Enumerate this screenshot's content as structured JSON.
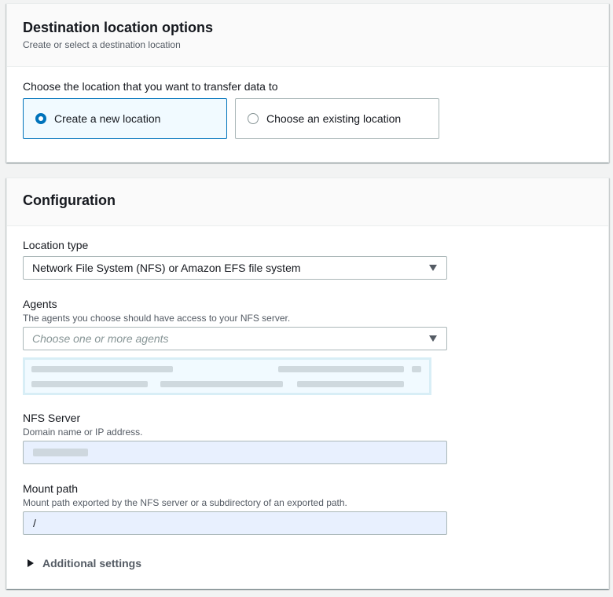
{
  "destination": {
    "title": "Destination location options",
    "description": "Create or select a destination location",
    "choose_label": "Choose the location that you want to transfer data to",
    "options": [
      {
        "label": "Create a new location",
        "selected": true
      },
      {
        "label": "Choose an existing location",
        "selected": false
      }
    ]
  },
  "configuration": {
    "title": "Configuration",
    "location_type": {
      "label": "Location type",
      "value": "Network File System (NFS) or Amazon EFS file system"
    },
    "agents": {
      "label": "Agents",
      "description": "The agents you choose should have access to your NFS server.",
      "placeholder": "Choose one or more agents"
    },
    "nfs_server": {
      "label": "NFS Server",
      "description": "Domain name or IP address."
    },
    "mount_path": {
      "label": "Mount path",
      "description": "Mount path exported by the NFS server or a subdirectory of an exported path.",
      "value": "/"
    },
    "additional_settings": "Additional settings"
  },
  "colors": {
    "accent": "#0073bb",
    "selected_bg": "#f1faff",
    "autofill_bg": "#e8f0fe"
  }
}
